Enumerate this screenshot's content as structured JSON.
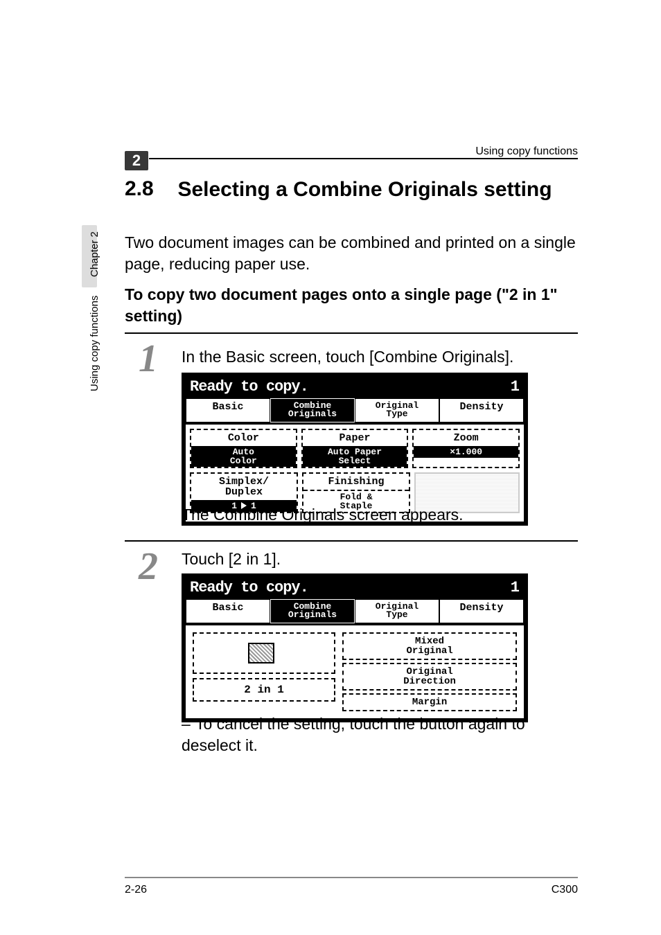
{
  "header": {
    "right": "Using copy functions"
  },
  "chapter": {
    "badge": "2",
    "sideChapter": "Chapter 2",
    "sideUsing": "Using copy functions"
  },
  "heading": {
    "num": "2.8",
    "text": "Selecting a Combine Originals setting"
  },
  "intro": "Two document images can be combined and printed on a single page, reducing paper use.",
  "subheading": "To copy two document pages onto a single page (\"2 in 1\" setting)",
  "step1": {
    "num": "1",
    "text": "In the Basic screen, touch [Combine Originals].",
    "afterText": "The Combine Originals screen appears.",
    "panel": {
      "ready": "Ready to copy.",
      "count": "1",
      "tabs": {
        "basic": "Basic",
        "combine1": "Combine",
        "combine2": "Originals",
        "orig1": "Original",
        "orig2": "Type",
        "density": "Density"
      },
      "cells": {
        "color": "Color",
        "colorSub": "Auto\nColor",
        "paper": "Paper",
        "paperSub": "Auto Paper\nSelect",
        "zoom": "Zoom",
        "zoomSub": "×1.000",
        "simplex": "Simplex/\nDuplex",
        "simplexSubL": "1",
        "simplexSubR": "1",
        "finishing": "Finishing",
        "fold": "Fold &\nStaple"
      }
    }
  },
  "step2": {
    "num": "2",
    "text": "Touch [2 in 1].",
    "note": "To cancel the setting, touch the button again to deselect it.",
    "panel": {
      "ready": "Ready to copy.",
      "count": "1",
      "tabs": {
        "basic": "Basic",
        "combine1": "Combine",
        "combine2": "Originals",
        "orig1": "Original",
        "orig2": "Type",
        "density": "Density"
      },
      "left": {
        "twoin1": "2 in 1"
      },
      "right": {
        "mixed": "Mixed\nOriginal",
        "direction": "Original\nDirection",
        "margin": "Margin"
      }
    }
  },
  "footer": {
    "left": "2-26",
    "right": "C300"
  }
}
